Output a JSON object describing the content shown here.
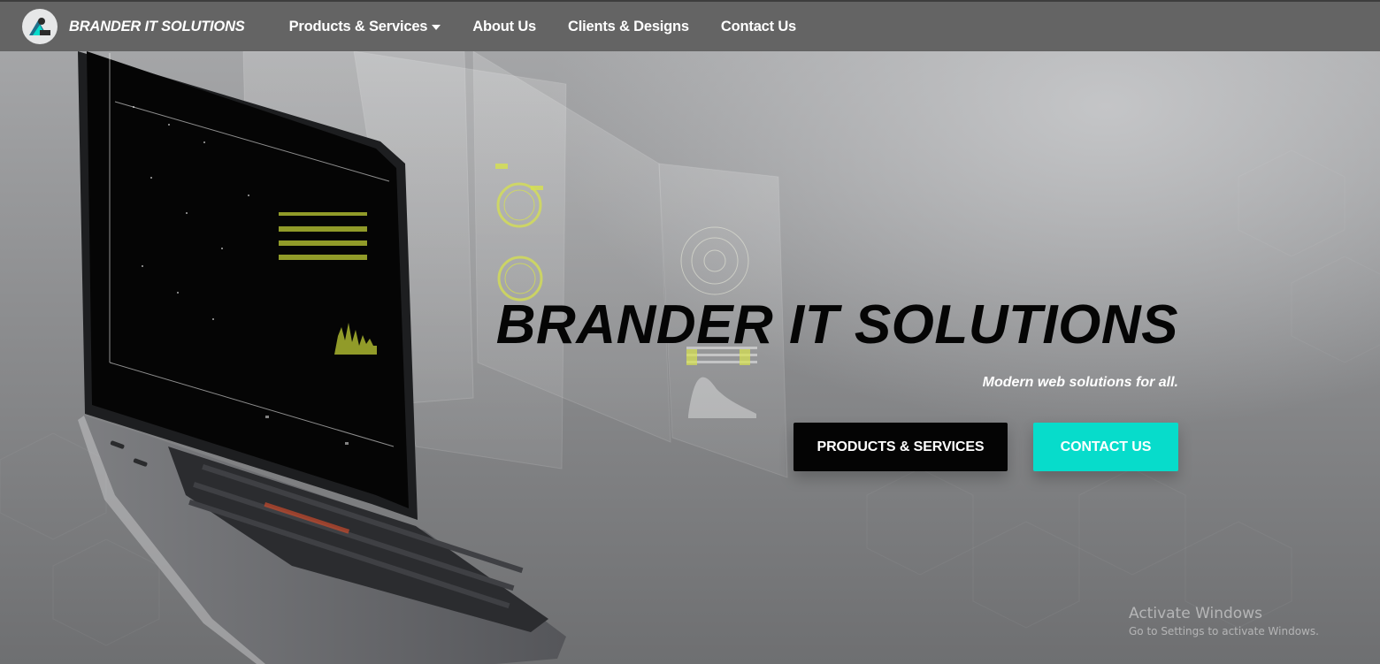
{
  "brand": {
    "name": "BRANDER IT SOLUTIONS",
    "logo_icon": "brand-logo-icon"
  },
  "nav": {
    "items": [
      {
        "label": "Products & Services",
        "has_dropdown": true
      },
      {
        "label": "About Us"
      },
      {
        "label": "Clients & Designs"
      },
      {
        "label": "Contact Us"
      }
    ]
  },
  "hero": {
    "title": "BRANDER IT SOLUTIONS",
    "subtitle": "Modern web solutions for all.",
    "buttons": {
      "primary": "PRODUCTS & SERVICES",
      "secondary": "CONTACT US"
    }
  },
  "watermark": {
    "title": "Activate Windows",
    "subtitle": "Go to Settings to activate Windows."
  },
  "colors": {
    "navbar": "#646464",
    "accent": "#07dccb",
    "dark_button": "#040404",
    "title": "#050505"
  }
}
